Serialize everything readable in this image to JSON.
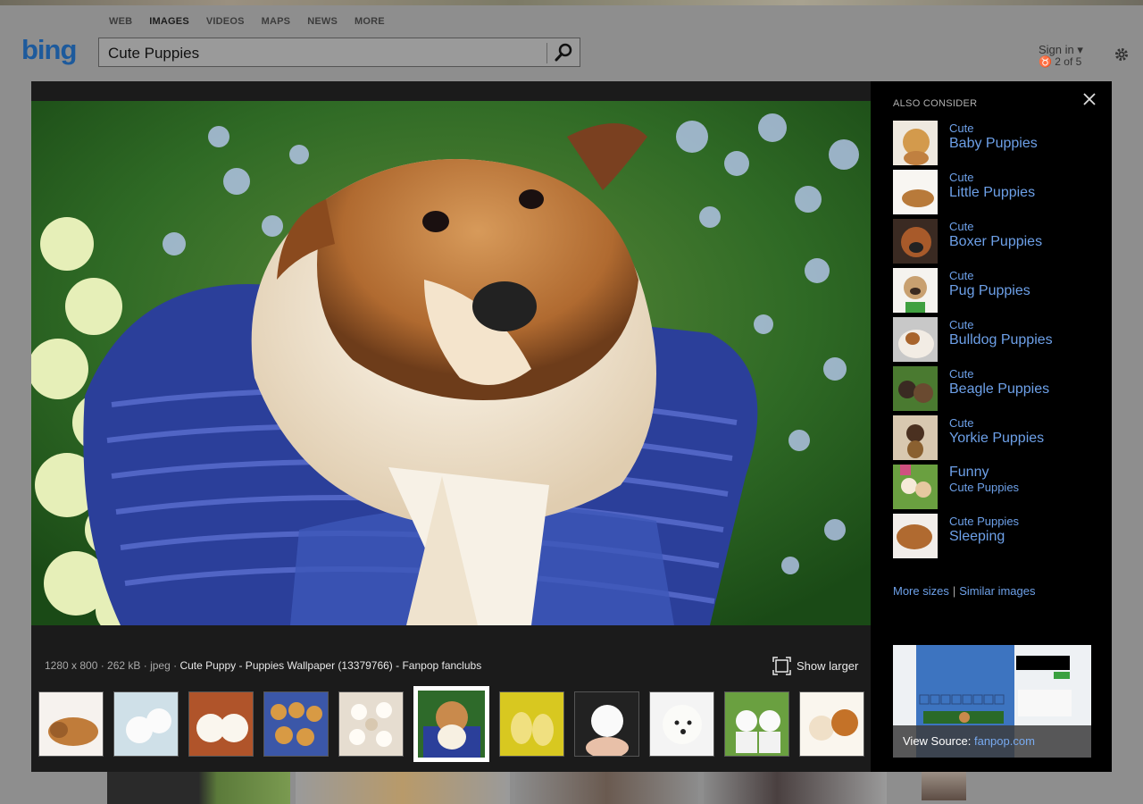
{
  "nav": [
    "WEB",
    "IMAGES",
    "VIDEOS",
    "MAPS",
    "NEWS",
    "MORE"
  ],
  "logo": "bing",
  "search": {
    "value": "Cute Puppies"
  },
  "header": {
    "sign_in": "Sign in ▾",
    "count": "2 of 5"
  },
  "overlay": {
    "also_consider": "ALSO CONSIDER",
    "info": {
      "meta": "1280 x 800 · 262 kB · jpeg · ",
      "title": "Cute Puppy - Puppies Wallpaper (13379766) - Fanpop fanclubs"
    },
    "show_larger": "Show larger",
    "suggestions": [
      {
        "small": "Cute",
        "big": "Baby Puppies",
        "first_small": true
      },
      {
        "small": "Cute",
        "big": "Little Puppies",
        "first_small": true
      },
      {
        "small": "Cute",
        "big": "Boxer Puppies",
        "first_small": true
      },
      {
        "small": "Cute",
        "big": "Pug Puppies",
        "first_small": true
      },
      {
        "small": "Cute",
        "big": "Bulldog Puppies",
        "first_small": true
      },
      {
        "small": "Cute",
        "big": "Beagle Puppies",
        "first_small": true
      },
      {
        "small": "Cute",
        "big": "Yorkie Puppies",
        "first_small": true
      },
      {
        "small": "Cute Puppies",
        "big": "Funny",
        "first_small": false
      },
      {
        "small": "Cute Puppies",
        "big": "Sleeping",
        "first_small": true
      }
    ],
    "more_sizes": "More sizes",
    "similar_images": "Similar images",
    "view_source": "View Source:",
    "source_domain": "fanpop.com",
    "selected_thumb_index": 5,
    "thumb_count": 11
  }
}
